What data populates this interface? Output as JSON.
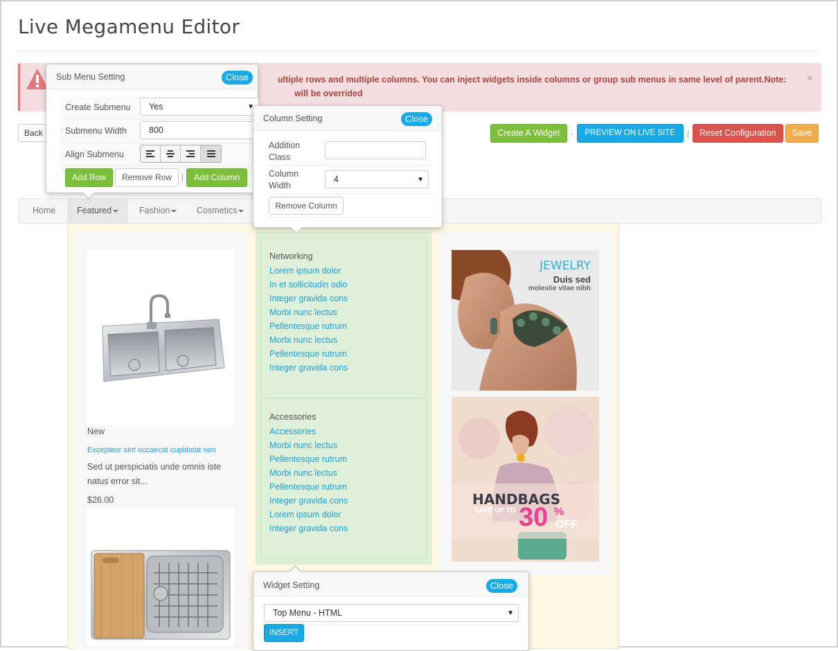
{
  "page": {
    "title": "Live Megamenu Editor"
  },
  "alert": {
    "line1": "ultiple rows and multiple columns. You can inject widgets inside columns or group sub menus in same level of parent.Note:",
    "line2": "will be overrided",
    "close": "×",
    "color": "#f2dede"
  },
  "toolbar": {
    "back_label": "Back",
    "create_widget": "Create A Widget",
    "dash": "-",
    "preview": "PREVIEW ON LIVE SITE",
    "pipe": "|",
    "reset": "Reset Configuration",
    "save": "Save"
  },
  "nav": {
    "items": [
      {
        "label": "Home"
      },
      {
        "label": "Featured"
      },
      {
        "label": "Fashion"
      },
      {
        "label": "Cosmetics"
      }
    ],
    "active": "Featured"
  },
  "submenu_setting": {
    "title": "Sub Menu Setting",
    "close": "Close",
    "create_label": "Create Submenu",
    "create_value": "Yes",
    "width_label": "Submenu Width",
    "width_value": "800",
    "align_label": "Align Submenu",
    "add_row": "Add Row",
    "remove_row": "Remove Row",
    "pipe": "|",
    "add_column": "Add Column"
  },
  "column_setting": {
    "title": "Column Setting",
    "close": "Close",
    "class_label_1": "Addition",
    "class_label_2": "Class",
    "class_value": "",
    "width_label_1": "Column",
    "width_label_2": "Width",
    "width_value": "4",
    "remove_column": "Remove Column"
  },
  "widget_setting": {
    "title": "Widget Setting",
    "close": "Close",
    "select_value": "Top Menu - HTML",
    "insert": "INSERT"
  },
  "product": {
    "tag": "New",
    "name": "Excepteur sint occaecat cupidatat non",
    "desc": "Sed ut perspiciatis unde omnis iste natus error sit...",
    "price": "$26.00"
  },
  "networking": {
    "title": "Networking",
    "links": [
      "Lorem ipsum dolor",
      "In et sollicitudin odio",
      "Integer gravida cons",
      "Morbi nunc lectus",
      "Pellentesque rutrum",
      "Morbi nunc lectus",
      "Pellentesque rutrum",
      "Integer gravida cons"
    ]
  },
  "accessories": {
    "title": "Accessories",
    "links": [
      "Accessories",
      "Morbi nunc lectus",
      "Pellentesque rutrum",
      "Morbi nunc lectus",
      "Pellentesque rutrum",
      "Integer gravida cons",
      "Lorem ipsum dolor",
      "Integer gravida cons"
    ]
  },
  "banners": {
    "jewelry_title": "JEWELRY",
    "jewelry_sub": "Duis sed",
    "jewelry_small": "molestie vitae nibh",
    "handbags_title": "HANDBAGS",
    "handbags_save": "SAVE UP TO",
    "handbags_pct": "30",
    "handbags_pct_sign": "%",
    "handbags_off": "OFF"
  },
  "colors": {
    "accent_blue": "#19a9e5",
    "green": "#7cbf3b",
    "red": "#d9534f",
    "orange": "#f0ad4e",
    "link": "#1ea0d8",
    "pink": "#ec3f8f"
  }
}
